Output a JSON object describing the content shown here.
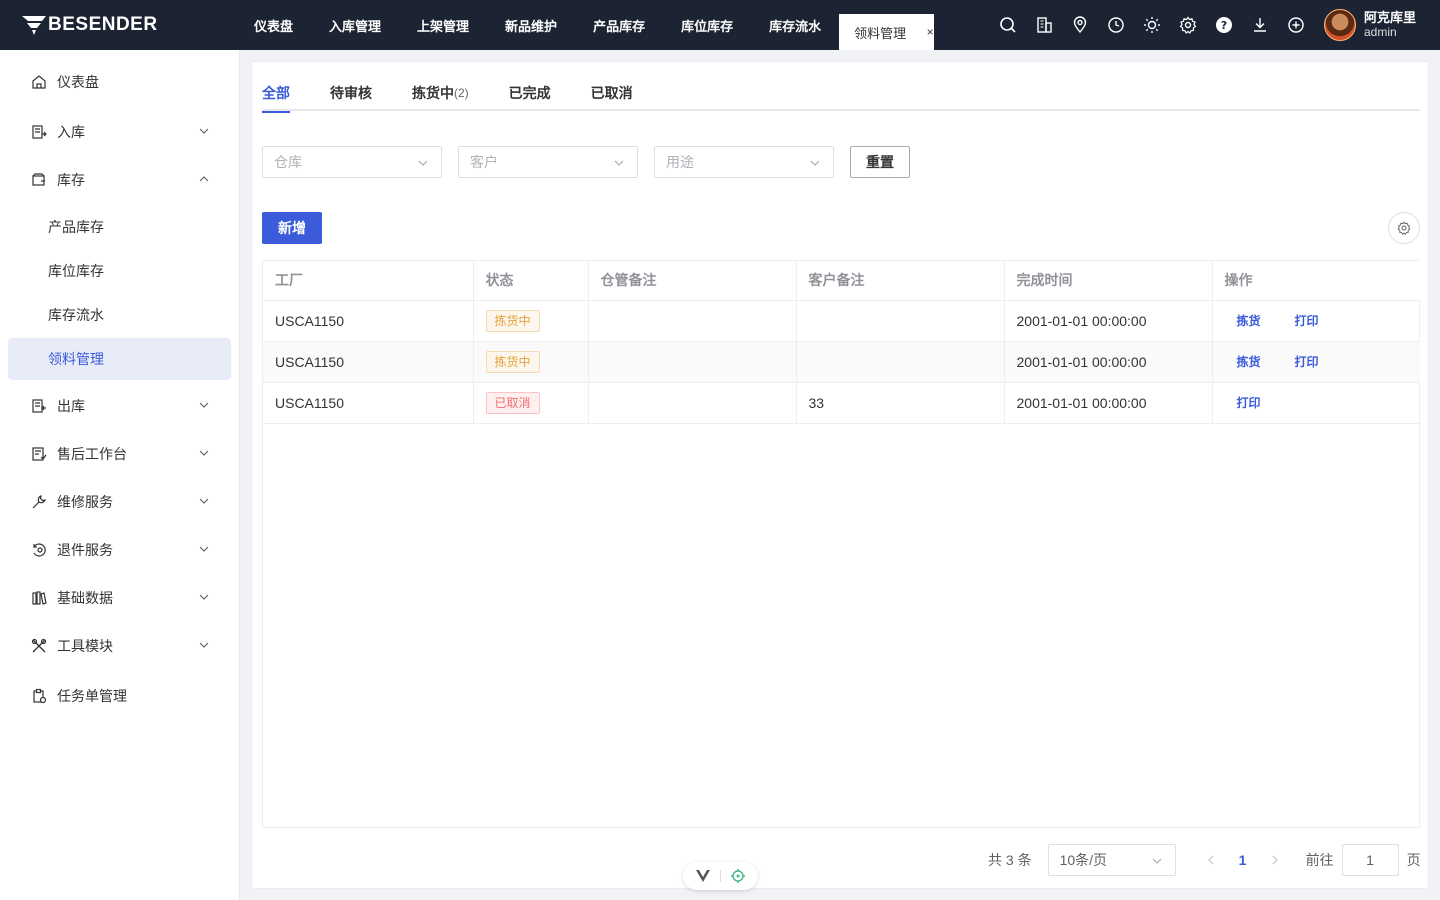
{
  "app": {
    "logo_text": "BESENDER",
    "brand_color": "#3b5bdb",
    "topbar_color": "#1c2434"
  },
  "topnav": {
    "items": [
      {
        "label": "仪表盘"
      },
      {
        "label": "入库管理"
      },
      {
        "label": "上架管理"
      },
      {
        "label": "新品维护"
      },
      {
        "label": "产品库存"
      },
      {
        "label": "库位库存"
      },
      {
        "label": "库存流水"
      }
    ],
    "active_tab": {
      "label": "领料管理",
      "close": "×"
    },
    "icons": [
      "search-icon",
      "building-icon",
      "location-icon",
      "clock-icon",
      "sun-icon",
      "gear-icon",
      "help-icon",
      "download-icon",
      "add-circle-icon"
    ]
  },
  "user": {
    "name": "阿克库里",
    "role": "admin"
  },
  "sidebar": {
    "items": [
      {
        "label": "仪表盘",
        "icon": "home-icon"
      },
      {
        "label": "入库",
        "icon": "inbound-icon",
        "expandable": true
      },
      {
        "label": "库存",
        "icon": "inventory-icon",
        "expandable": true,
        "expanded": true
      },
      {
        "label": "出库",
        "icon": "outbound-icon",
        "expandable": true
      },
      {
        "label": "售后工作台",
        "icon": "aftersales-icon",
        "expandable": true
      },
      {
        "label": "维修服务",
        "icon": "wrench-icon",
        "expandable": true
      },
      {
        "label": "退件服务",
        "icon": "return-icon",
        "expandable": true
      },
      {
        "label": "基础数据",
        "icon": "data-icon",
        "expandable": true
      },
      {
        "label": "工具模块",
        "icon": "tools-icon",
        "expandable": true
      },
      {
        "label": "任务单管理",
        "icon": "task-icon"
      }
    ],
    "subitems": [
      {
        "label": "产品库存"
      },
      {
        "label": "库位库存"
      },
      {
        "label": "库存流水"
      },
      {
        "label": "领料管理",
        "active": true
      }
    ]
  },
  "tabs": [
    {
      "label": "全部",
      "active": true
    },
    {
      "label": "待审核"
    },
    {
      "label": "拣货中",
      "count": "(2)"
    },
    {
      "label": "已完成"
    },
    {
      "label": "已取消"
    }
  ],
  "filters": {
    "warehouse_placeholder": "仓库",
    "customer_placeholder": "客户",
    "purpose_placeholder": "用途",
    "reset_label": "重置"
  },
  "toolbar": {
    "add_label": "新增"
  },
  "table": {
    "columns": [
      "工厂",
      "状态",
      "仓管备注",
      "客户备注",
      "完成时间",
      "操作"
    ],
    "rows": [
      {
        "factory": "USCA1150",
        "status": "拣货中",
        "status_type": "picking",
        "wh_note": "",
        "cust_note": "",
        "finish_time": "2001-01-01 00:00:00",
        "ops": [
          "拣货",
          "打印"
        ]
      },
      {
        "factory": "USCA1150",
        "status": "拣货中",
        "status_type": "picking",
        "wh_note": "",
        "cust_note": "",
        "finish_time": "2001-01-01 00:00:00",
        "ops": [
          "拣货",
          "打印"
        ]
      },
      {
        "factory": "USCA1150",
        "status": "已取消",
        "status_type": "cancel",
        "wh_note": "",
        "cust_note": "33",
        "finish_time": "2001-01-01 00:00:00",
        "ops": [
          "打印"
        ]
      }
    ]
  },
  "pagination": {
    "total": "共 3 条",
    "page_size": "10条/页",
    "current_page": "1",
    "goto_label": "前往",
    "goto_value": "1",
    "page_suffix": "页"
  }
}
